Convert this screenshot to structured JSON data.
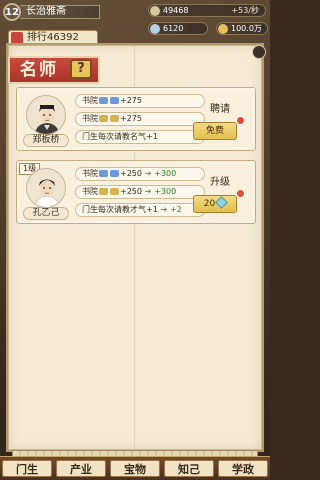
{
  "hud": {
    "level": "12",
    "player_name": "长治雅斋",
    "rank_label": "排行46392",
    "coins": "49468",
    "coin_rate": "+53/秒",
    "food": "6120",
    "gold": "100.0万"
  },
  "panel": {
    "title": "名师",
    "help_label": "?"
  },
  "teachers": [
    {
      "name": "郑板桥",
      "level": "",
      "attrs": [
        {
          "label": "书院",
          "value": "+275"
        },
        {
          "label": "书院",
          "value": "+275"
        },
        {
          "label": "门生每次请教名气+1"
        }
      ],
      "action_label": "聘请",
      "button_label": "免费"
    },
    {
      "name": "孔乙己",
      "level": "1级",
      "attrs": [
        {
          "label": "书院",
          "value": "+250",
          "next": "+300"
        },
        {
          "label": "书院",
          "value": "+250",
          "next": "+300"
        },
        {
          "label": "门生每次请教才气+1",
          "next": "+2"
        }
      ],
      "action_label": "升级",
      "button_label": "20"
    }
  ],
  "nav": [
    "门生",
    "产业",
    "宝物",
    "知己",
    "学政"
  ]
}
